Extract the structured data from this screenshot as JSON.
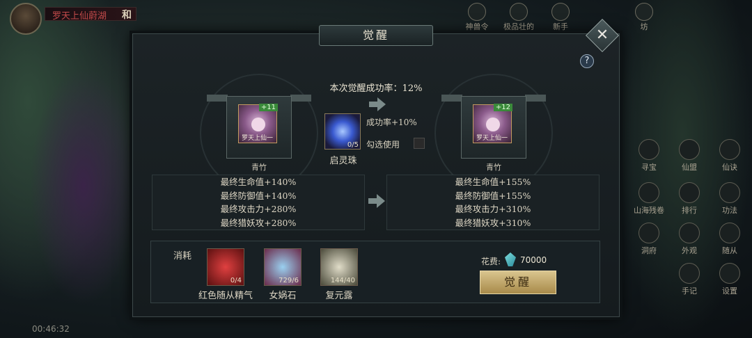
{
  "hud": {
    "player_name": "罗天上仙蔚湖",
    "player_tag": "和",
    "clock": "00:46:32",
    "top_icons": [
      "神兽令",
      "极品壮的",
      "新手",
      "坊"
    ],
    "side_icons": [
      "寻宝",
      "仙盟",
      "仙诀",
      "山海残卷",
      "排行",
      "功法",
      "洞府",
      "外观",
      "随从",
      "手记",
      "设置"
    ]
  },
  "modal": {
    "title": "觉醒",
    "close_symbol": "✕",
    "help_symbol": "?",
    "success_rate_text": "本次觉醒成功率：12%",
    "left_char": {
      "level": "+11",
      "name_plate": "罗天上仙一",
      "label": "青竹"
    },
    "right_char": {
      "level": "+12",
      "name_plate": "罗天上仙一",
      "label": "青竹"
    },
    "item": {
      "name": "启灵珠",
      "count": "0/5",
      "bonus": "成功率+10%",
      "check_label": "勾选使用"
    },
    "left_stats": [
      "最终生命值+140%",
      "最终防御值+140%",
      "最终攻击力+280%",
      "最终猎妖攻+280%"
    ],
    "right_stats": [
      "最终生命值+155%",
      "最终防御值+155%",
      "最终攻击力+310%",
      "最终猎妖攻+310%"
    ],
    "consume": {
      "label": "消耗",
      "materials": [
        {
          "name": "红色随从精气",
          "count": "0/4",
          "color": "#7a1a1a"
        },
        {
          "name": "女娲石",
          "count": "729/6",
          "color": "#5a2a4a"
        },
        {
          "name": "复元露",
          "count": "144/40",
          "color": "#4a4a3a"
        }
      ],
      "cost_label": "花费:",
      "cost_value": "70000",
      "button_label": "觉醒"
    }
  }
}
